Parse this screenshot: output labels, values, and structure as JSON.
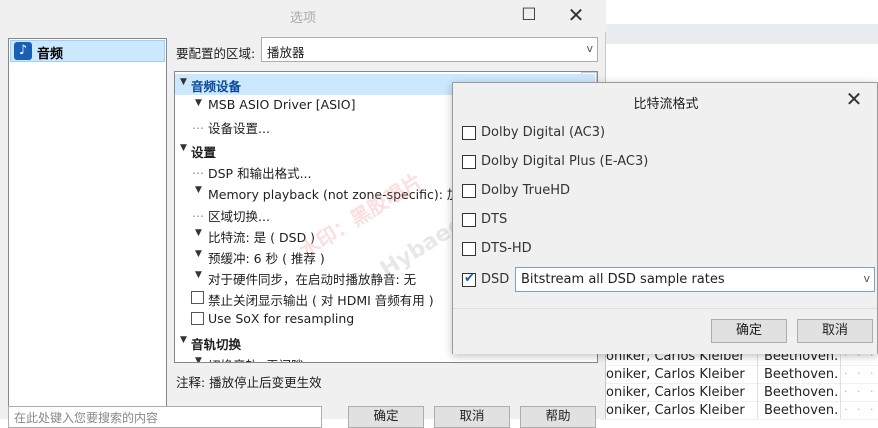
{
  "background_list": {
    "rows": [
      {
        "artist": "oniker, Carlos Kleiber",
        "work": "Beethoven..."
      },
      {
        "artist": "oniker, Carlos Kleiber",
        "work": "Beethoven..."
      },
      {
        "artist": "oniker, Carlos Kleiber",
        "work": "Beethoven..."
      },
      {
        "artist": "oniker, Carlos Kleiber",
        "work": "Beethoven..."
      }
    ],
    "dots": "· · ·"
  },
  "options_window": {
    "title": "选项",
    "minimize_glyph": "☐",
    "close_glyph": "✕",
    "categories": [
      {
        "label": "音频",
        "icon": "music-note-icon",
        "icon_glyph": "♪"
      }
    ],
    "zone_label": "要配置的区域:",
    "zone_value": "播放器",
    "select_arrow": "v",
    "tree": {
      "audio_device_group": "音频设备",
      "driver": "MSB ASIO Driver [ASIO]",
      "device_settings": "设备设置...",
      "settings_group": "设置",
      "dsp": "DSP 和输出格式...",
      "memory_playback": "Memory playback (not zone-specific): 加载",
      "zone_switch": "区域切换...",
      "bitstream": "比特流: 是 ( DSD )",
      "prebuffer": "预缓冲: 6 秒 ( 推荐 )",
      "hw_sync": "对于硬件同步，在启动时播放静音: 无",
      "disable_display": "禁止关闭显示输出 ( 对 HDMI 音频有用 )",
      "use_sox": "Use SoX for resampling",
      "track_switch_group": "音轨切换",
      "switch_track": "切换音轨: 无间隙"
    },
    "note": "注释: 播放停止后变更生效",
    "search_placeholder": "在此处键入您要搜索的内容",
    "buttons": {
      "ok": "确定",
      "cancel": "取消",
      "help": "帮助"
    }
  },
  "watermark": {
    "cn": "水印：黑胶唱片",
    "en": "Hybaeee.com"
  },
  "bitstream_dialog": {
    "title": "比特流格式",
    "close_glyph": "✕",
    "options": [
      {
        "label": "Dolby Digital (AC3)",
        "checked": false
      },
      {
        "label": "Dolby Digital Plus (E-AC3)",
        "checked": false
      },
      {
        "label": "Dolby TrueHD",
        "checked": false
      },
      {
        "label": "DTS",
        "checked": false
      },
      {
        "label": "DTS-HD",
        "checked": false
      },
      {
        "label": "DSD",
        "checked": true
      }
    ],
    "check_glyph": "✔",
    "dsd_mode": "Bitstream all DSD sample rates",
    "ok_label": "确定",
    "cancel_label": "取消"
  }
}
